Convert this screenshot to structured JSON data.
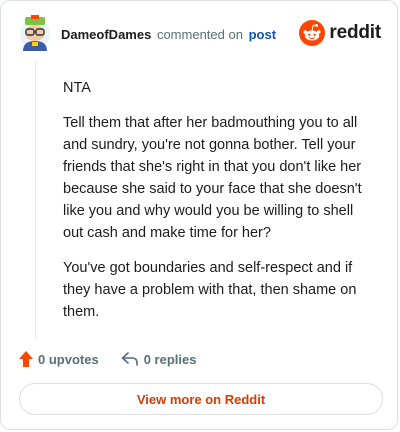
{
  "header": {
    "username": "DameofDames",
    "commented_text": "commented on",
    "post_link": "post",
    "logo_text": "reddit"
  },
  "comment": {
    "paragraphs": [
      "NTA",
      "Tell them that after her badmouthing you to all and sundry, you're not gonna bother. Tell your friends that she's right in that you don't like her because she said to your face that she doesn't like you and why would you be willing to shell out cash and make time for her?",
      "You've got boundaries and self-respect and if they have a problem with that, then shame on them."
    ]
  },
  "footer": {
    "upvotes": "0 upvotes",
    "replies": "0 replies"
  },
  "view_more": "View more on Reddit",
  "colors": {
    "reddit_orange": "#ff4500",
    "link_blue": "#0a57b4",
    "upvote_orange": "#d93a00"
  }
}
